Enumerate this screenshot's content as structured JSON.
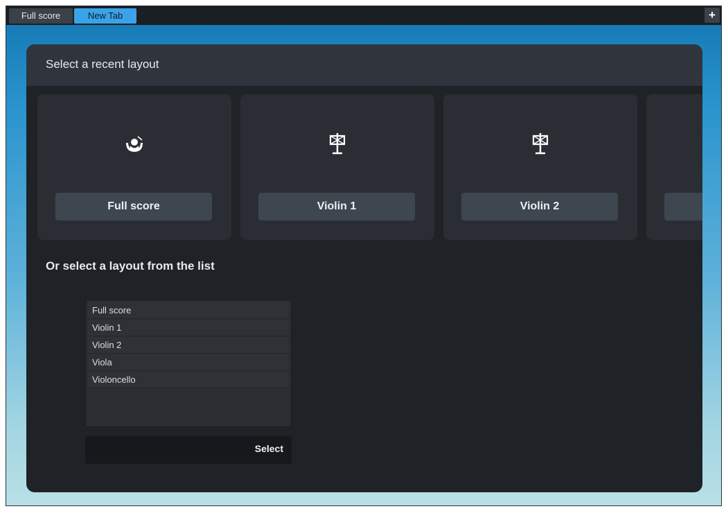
{
  "tabs": [
    {
      "label": "Full score",
      "active": false
    },
    {
      "label": "New Tab",
      "active": true
    }
  ],
  "new_tab_icon": "plus-icon",
  "recent": {
    "title": "Select a recent layout",
    "cards": [
      {
        "label": "Full score",
        "icon": "conductor-icon"
      },
      {
        "label": "Violin 1",
        "icon": "music-stand-icon"
      },
      {
        "label": "Violin 2",
        "icon": "music-stand-icon"
      },
      {
        "label": "",
        "icon": "music-stand-icon"
      }
    ]
  },
  "list_section": {
    "title": "Or select a layout from the list",
    "items": [
      "Full score",
      "Violin 1",
      "Violin 2",
      "Viola",
      "Violoncello"
    ],
    "select_label": "Select"
  },
  "colors": {
    "active_tab": "#3aa3e8",
    "panel": "#1f2226",
    "card": "#2a2e34",
    "card_button": "#3e4650"
  }
}
